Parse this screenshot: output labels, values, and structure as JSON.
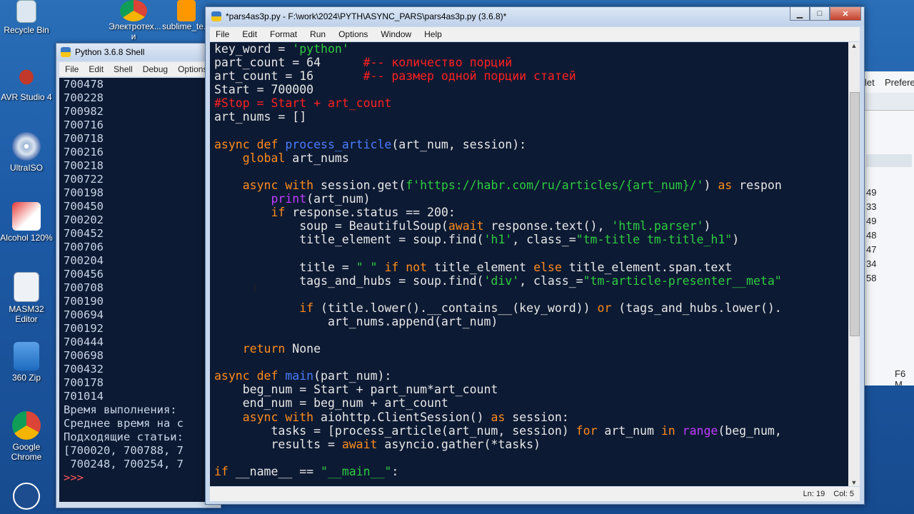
{
  "desktop": {
    "icons": [
      {
        "label": "Recycle Bin"
      },
      {
        "label": "AVR Studio 4"
      },
      {
        "label": "UltraISO"
      },
      {
        "label": "Alcohol 120%"
      },
      {
        "label": "MASM32 Editor"
      },
      {
        "label": "360 Zip"
      },
      {
        "label": "Google Chrome"
      }
    ],
    "top_icons": [
      {
        "label": "Электротех... и электрон..."
      },
      {
        "label": "sublime_te..."
      }
    ]
  },
  "shell": {
    "title": "Python 3.6.8 Shell",
    "menu": [
      "File",
      "Edit",
      "Shell",
      "Debug",
      "Options"
    ],
    "output_lines": [
      "700478",
      "700228",
      "700982",
      "700716",
      "700718",
      "700216",
      "700218",
      "700722",
      "700198",
      "700450",
      "700202",
      "700452",
      "700706",
      "700204",
      "700456",
      "700708",
      "700190",
      "700694",
      "700192",
      "700444",
      "700698",
      "700432",
      "700178",
      "701014",
      "Время выполнения: ",
      "Среднее время на с",
      "Подходящие статьи:",
      "[700020, 700788, 7",
      " 700248, 700254, 7"
    ],
    "prompt": ">>>"
  },
  "editor": {
    "title": "*pars4as3p.py - F:\\work\\2024\\PYTH\\ASYNC_PARS\\pars4as3p.py (3.6.8)*",
    "menu": [
      "File",
      "Edit",
      "Format",
      "Run",
      "Options",
      "Window",
      "Help"
    ],
    "status": {
      "line": "Ln: 19",
      "col": "Col: 5"
    }
  },
  "bgwin": {
    "items": [
      "let",
      "Prefere",
      "49",
      "33",
      "49",
      "48",
      "47",
      "34",
      "58",
      "F6 M"
    ]
  },
  "colors": {
    "code_bg": "#0d1a33",
    "keyword": "#ff8c1a",
    "string": "#2ecc40",
    "comment": "#ff2020",
    "defname": "#4a7dff",
    "builtin": "#c03cff"
  }
}
